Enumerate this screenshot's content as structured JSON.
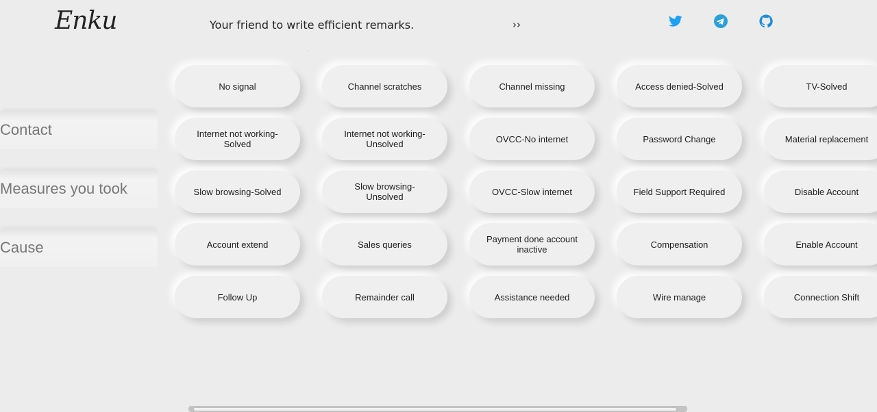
{
  "header": {
    "logo": "Enku",
    "tagline": "Your friend to write efficient remarks.",
    "toggle": "››"
  },
  "social": [
    {
      "name": "twitter-icon",
      "color": "#1da1f2"
    },
    {
      "name": "telegram-icon",
      "color": "#2a9fd8"
    },
    {
      "name": "github-icon",
      "color": "#1e8fd6"
    }
  ],
  "sidebar": {
    "items": [
      {
        "label": "Contact"
      },
      {
        "label": "Measures you took"
      },
      {
        "label": "Cause"
      }
    ]
  },
  "remarks": [
    [
      "No signal",
      "Channel scratches",
      "Channel missing",
      "Access denied-Solved",
      "TV-Solved"
    ],
    [
      "Internet not working-Solved",
      "Internet not working-Unsolved",
      "OVCC-No internet",
      "Password Change",
      "Material replacement"
    ],
    [
      "Slow browsing-Solved",
      "Slow browsing-Unsolved",
      "OVCC-Slow internet",
      "Field Support Required",
      "Disable Account"
    ],
    [
      "Account extend",
      "Sales queries",
      "Payment done account inactive",
      "Compensation",
      "Enable Account"
    ],
    [
      "Follow Up",
      "Remainder call",
      "Assistance needed",
      "Wire manage",
      "Connection Shift"
    ]
  ]
}
